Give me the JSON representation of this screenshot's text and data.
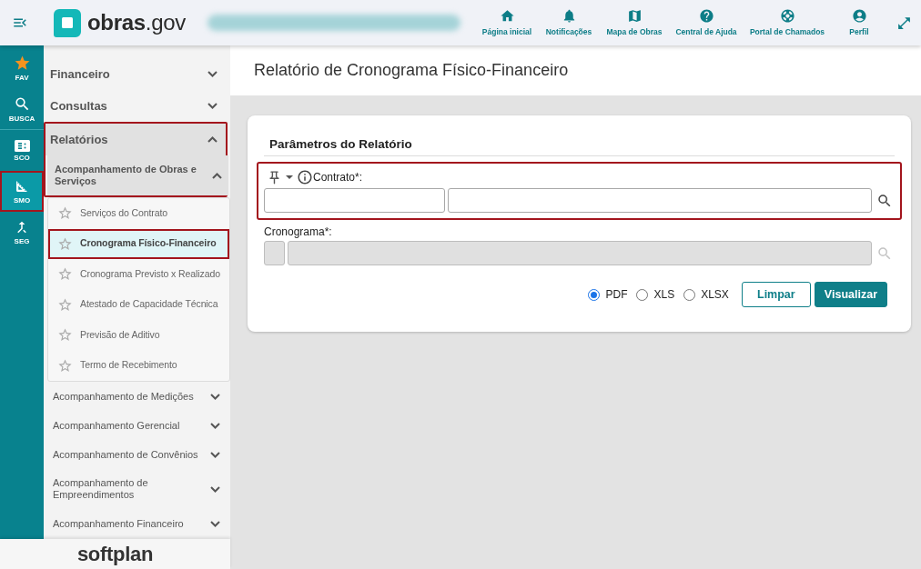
{
  "header": {
    "logo": {
      "name": "obras",
      "suffix": ".gov"
    },
    "nav": [
      {
        "label": "Página inicial"
      },
      {
        "label": "Notificações"
      },
      {
        "label": "Mapa de Obras"
      },
      {
        "label": "Central de Ajuda"
      },
      {
        "label": "Portal de Chamados"
      },
      {
        "label": "Perfil"
      }
    ]
  },
  "rail": {
    "top": [
      {
        "label": "FAV",
        "selected": false,
        "highlighted": false
      },
      {
        "label": "BUSCA",
        "selected": false,
        "highlighted": false
      }
    ],
    "modules": [
      {
        "label": "SCO",
        "selected": false,
        "highlighted": false
      },
      {
        "label": "SMO",
        "selected": true,
        "highlighted": true
      },
      {
        "label": "SEG",
        "selected": false,
        "highlighted": false
      }
    ]
  },
  "sidebar": {
    "items": [
      {
        "label": "Financeiro",
        "expanded": false,
        "highlighted": false
      },
      {
        "label": "Consultas",
        "expanded": false,
        "highlighted": false
      },
      {
        "label": "Relatórios",
        "expanded": true,
        "highlighted": true,
        "children": [
          {
            "label": "Acompanhamento de Obras e Serviços",
            "expanded": true,
            "highlighted": true,
            "children": [
              {
                "label": "Serviços do Contrato",
                "selected": false,
                "highlighted": false
              },
              {
                "label": "Cronograma Físico-Financeiro",
                "selected": true,
                "highlighted": true
              },
              {
                "label": "Cronograma Previsto x Realizado",
                "selected": false,
                "highlighted": false
              },
              {
                "label": "Atestado de Capacidade Técnica",
                "selected": false,
                "highlighted": false
              },
              {
                "label": "Previsão de Aditivo",
                "selected": false,
                "highlighted": false
              },
              {
                "label": "Termo de Recebimento",
                "selected": false,
                "highlighted": false
              }
            ]
          },
          {
            "label": "Acompanhamento de Medições",
            "expanded": false,
            "highlighted": false
          },
          {
            "label": "Acompanhamento Gerencial",
            "expanded": false,
            "highlighted": false
          },
          {
            "label": "Acompanhamento de Convênios",
            "expanded": false,
            "highlighted": false
          },
          {
            "label": "Acompanhamento de Empreendimentos",
            "expanded": false,
            "highlighted": false
          },
          {
            "label": "Acompanhamento Financeiro",
            "expanded": false,
            "highlighted": false
          }
        ]
      }
    ]
  },
  "footer": {
    "brand": "softplan"
  },
  "page": {
    "title": "Relatório de Cronograma Físico-Financeiro"
  },
  "form": {
    "title": "Parâmetros do Relatório",
    "fields": [
      {
        "label": "Contrato*:",
        "kind": "tools",
        "disabled": false,
        "highlighted": true
      },
      {
        "label": "Cronograma*:",
        "kind": "plain",
        "disabled": true,
        "highlighted": false
      }
    ],
    "formats": [
      {
        "label": "PDF",
        "selected": true
      },
      {
        "label": "XLS",
        "selected": false
      },
      {
        "label": "XLSX",
        "selected": false
      }
    ],
    "buttons": [
      {
        "label": "Limpar",
        "kind": "outline"
      },
      {
        "label": "Visualizar",
        "kind": "primary"
      }
    ]
  }
}
